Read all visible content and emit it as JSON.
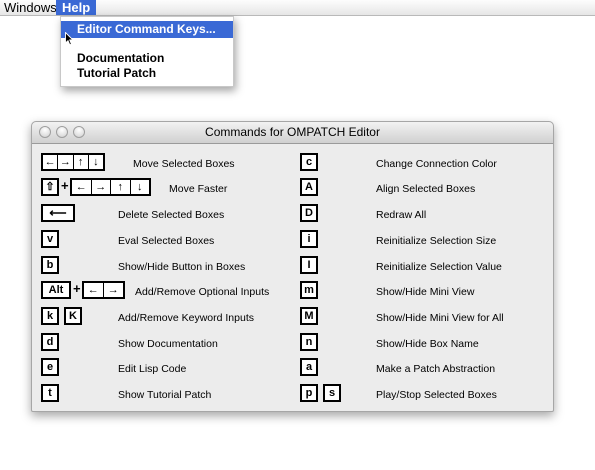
{
  "menubar": {
    "windows": "Windows",
    "help": "Help"
  },
  "help_menu": {
    "items": [
      "Editor Command Keys...",
      "Documentation",
      "Tutorial Patch"
    ]
  },
  "window": {
    "title": "Commands for OMPATCH Editor"
  },
  "left_commands": [
    {
      "keys": [
        "←",
        "→",
        "↑",
        "↓"
      ],
      "label": "Move Selected Boxes"
    },
    {
      "keys": [
        "⇧",
        "+",
        "←",
        "→",
        "↑",
        "↓"
      ],
      "label": "Move Faster"
    },
    {
      "keys": [
        "⟵"
      ],
      "label": "Delete Selected Boxes"
    },
    {
      "keys": [
        "v"
      ],
      "label": "Eval Selected Boxes"
    },
    {
      "keys": [
        "b"
      ],
      "label": "Show/Hide Button in Boxes"
    },
    {
      "keys": [
        "Alt",
        "+",
        "←",
        "→"
      ],
      "label": "Add/Remove Optional Inputs"
    },
    {
      "keys": [
        "k",
        "K"
      ],
      "label": "Add/Remove Keyword Inputs"
    },
    {
      "keys": [
        "d"
      ],
      "label": "Show Documentation"
    },
    {
      "keys": [
        "e"
      ],
      "label": "Edit Lisp Code"
    },
    {
      "keys": [
        "t"
      ],
      "label": "Show Tutorial Patch"
    }
  ],
  "right_commands": [
    {
      "keys": [
        "c"
      ],
      "label": "Change Connection Color"
    },
    {
      "keys": [
        "A"
      ],
      "label": "Align Selected Boxes"
    },
    {
      "keys": [
        "D"
      ],
      "label": "Redraw All"
    },
    {
      "keys": [
        "i"
      ],
      "label": "Reinitialize Selection Size"
    },
    {
      "keys": [
        "I"
      ],
      "label": "Reinitialize Selection Value"
    },
    {
      "keys": [
        "m"
      ],
      "label": "Show/Hide Mini View"
    },
    {
      "keys": [
        "M"
      ],
      "label": "Show/Hide Mini View for All"
    },
    {
      "keys": [
        "n"
      ],
      "label": "Show/Hide Box Name"
    },
    {
      "keys": [
        "a"
      ],
      "label": "Make a Patch Abstraction"
    },
    {
      "keys": [
        "p",
        "s"
      ],
      "label": "Play/Stop Selected Boxes"
    }
  ]
}
